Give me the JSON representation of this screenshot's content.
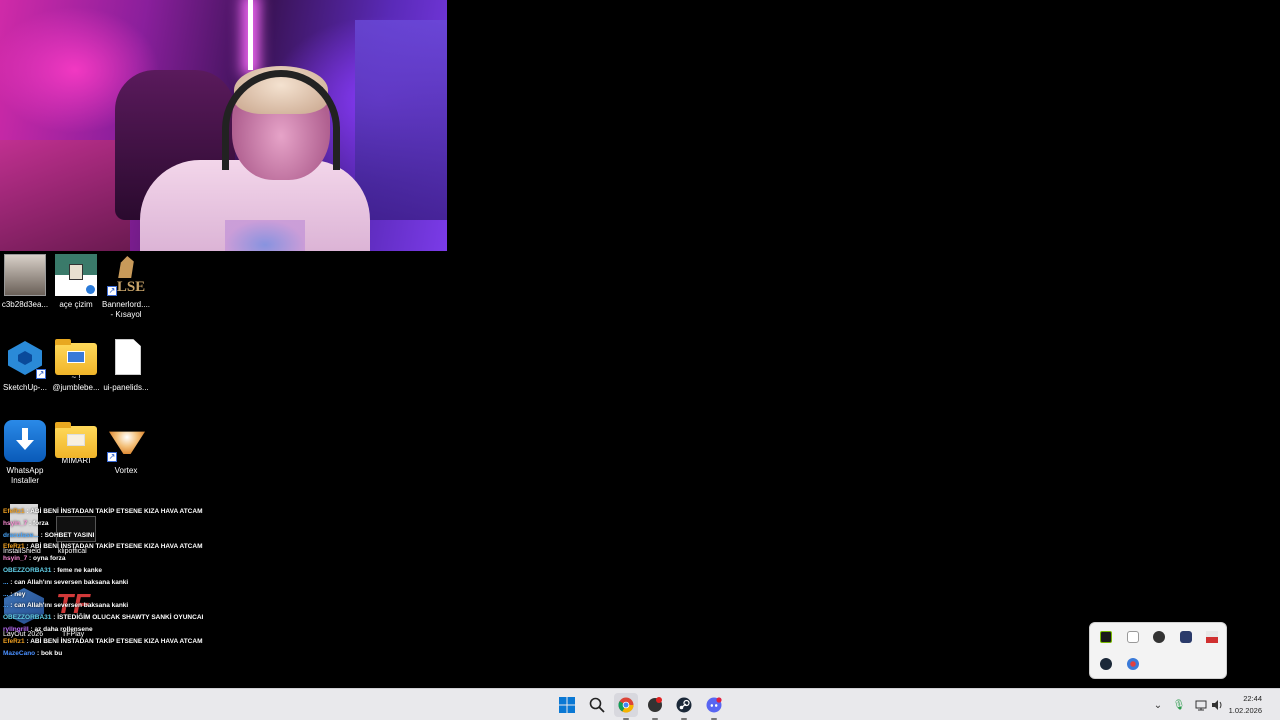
{
  "desktop": {
    "icons": [
      {
        "label_line1": "c3b28d3ea...",
        "label_line2": ""
      },
      {
        "label_line1": "açe çizim",
        "label_line2": ""
      },
      {
        "label_line1": "Bannerlord....",
        "label_line2": "- Kısayol"
      },
      {
        "label_line1": "SketchUp-...",
        "label_line2": ""
      },
      {
        "label_line1": "~ !",
        "label_line2": "@jumblebe..."
      },
      {
        "label_line1": "ui-panelids...",
        "label_line2": ""
      },
      {
        "label_line1": "WhatsApp",
        "label_line2": "Installer"
      },
      {
        "label_line1": "MİMARİ",
        "label_line2": ""
      },
      {
        "label_line1": "Vortex",
        "label_line2": ""
      }
    ]
  },
  "chat": {
    "messages": [
      {
        "user": "EfeRz1",
        "text": "ABİ BENİ İNSTADAN TAKİP ETSENE KIZA HAVA ATCAM",
        "color": "#f0a020"
      },
      {
        "user": "hsyin_7",
        "text": "forza",
        "color": "#ff8fd8"
      },
      {
        "user": "draculase...",
        "text": "SOHBET YASINI",
        "color": "#4aa8ff"
      },
      {
        "user": "EfeRz1",
        "text": "ABİ BENİ İNSTADAN TAKİP ETSENE KIZA HAVA ATCAM",
        "color": "#f0a020"
      },
      {
        "user": "hsyin_7",
        "text": "oyna forza",
        "color": "#ff8fd8"
      },
      {
        "user": "OBEZZORBA31",
        "text": "feme ne kanke",
        "color": "#62d0e8"
      },
      {
        "user": "...",
        "text": "can Allah'ını seversen baksana kanki",
        "color": "#4aa8ff"
      },
      {
        "user": "...",
        "text": "ney",
        "color": "#4aa8ff"
      },
      {
        "user": "...",
        "text": "can Allah'ını seversen baksana kanki",
        "color": "#4aa8ff"
      },
      {
        "user": "OBEZZORBA31",
        "text": "İSTEDİĞİM OLUCAK SHAWTY SANKİ OYUNCAK",
        "color": "#62d0e8"
      },
      {
        "user": "ryllngrill",
        "text": "az daha rollensene",
        "color": "#c070ff"
      },
      {
        "user": "EfeRz1",
        "text": "ABİ BENİ İNSTADAN TAKİP ETSENE KIZA HAVA ATCAM",
        "color": "#f0a020"
      },
      {
        "user": "MazeCano",
        "text": "bok bu",
        "color": "#4a90ff"
      }
    ]
  },
  "overlay_icon_labels": {
    "installshield": "InstallShield",
    "klipofficial": "klipoffical",
    "layout": "LayOut 2026",
    "tf": "TFPlay"
  },
  "taskbar": {
    "apps": [
      "start-icon",
      "search-icon",
      "chrome-icon",
      "app-red-icon",
      "steam-icon",
      "discord-icon"
    ],
    "clock_time": "22:44",
    "clock_date": "1.02.2026"
  },
  "colors": {
    "taskbar_bg": "#e9e9ec",
    "windows_blue": "#0a78d4",
    "discord": "#5865f2",
    "steam": "#1b2838"
  }
}
